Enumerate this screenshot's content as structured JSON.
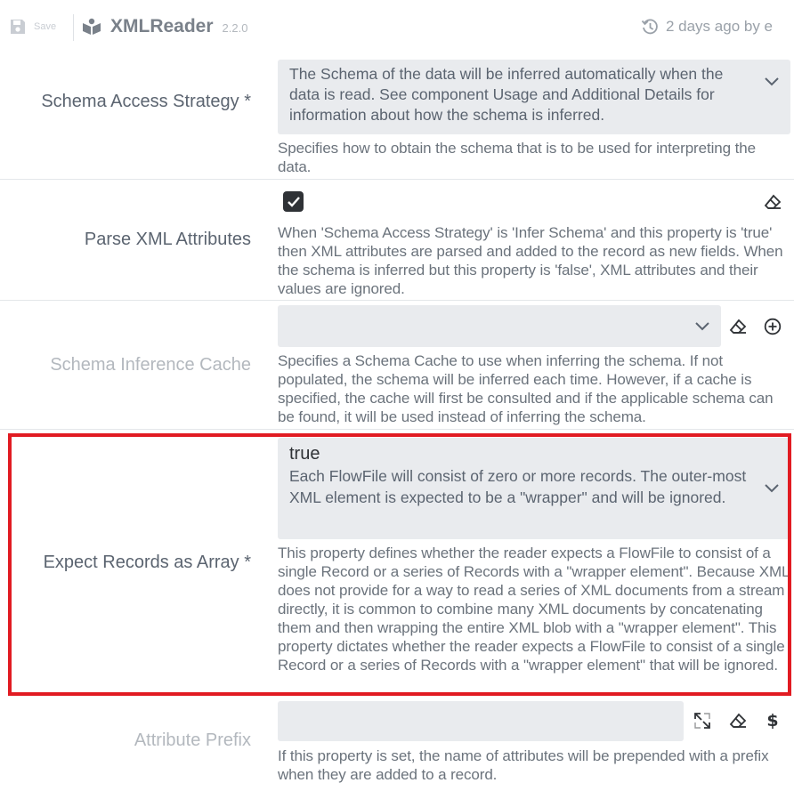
{
  "toolbar": {
    "save_label": "Save",
    "component_name": "XMLReader",
    "component_version": "2.2.0",
    "history_text": "2 days ago by e"
  },
  "properties": [
    {
      "label": "Schema Access Strategy *",
      "value": "The Schema of the data will be inferred automatically when the data is read. See component Usage and Additional Details for information about how the schema is inferred.",
      "description": "Specifies how to obtain the schema that is to be used for interpreting the data."
    },
    {
      "label": "Parse XML Attributes",
      "checked": true,
      "description": "When 'Schema Access Strategy' is 'Infer Schema' and this property is 'true' then XML attributes are parsed and added to the record as new fields. When the schema is inferred but this property is 'false', XML attributes and their values are ignored."
    },
    {
      "label": "Schema Inference Cache",
      "value": "",
      "description": "Specifies a Schema Cache to use when inferring the schema. If not populated, the schema will be inferred each time. However, if a cache is specified, the cache will first be consulted and if the applicable schema can be found, it will be used instead of inferring the schema."
    },
    {
      "label": "Expect Records as Array *",
      "value_title": "true",
      "value_description": "Each FlowFile will consist of zero or more records. The outer-most XML element is expected to be a \"wrapper\" and will be ignored.",
      "description": "This property defines whether the reader expects a FlowFile to consist of a single Record or a series of Records with a \"wrapper element\". Because XML does not provide for a way to read a series of XML documents from a stream directly, it is common to combine many XML documents by concatenating them and then wrapping the entire XML blob with a \"wrapper element\". This property dictates whether the reader expects a FlowFile to consist of a single Record or a series of Records with a \"wrapper element\" that will be ignored."
    },
    {
      "label": "Attribute Prefix",
      "value": "",
      "description": "If this property is set, the name of attributes will be prepended with a prefix when they are added to a record."
    }
  ],
  "icons": {
    "save": "floppy-disk-icon",
    "component": "component-box-icon",
    "history": "history-clock-icon",
    "clear": "eraser-icon",
    "add": "plus-circle-icon",
    "expand": "expand-arrows-icon",
    "expression": "dollar-icon"
  },
  "colors": {
    "highlight": "#e11b22",
    "field_bg": "#e9ebee",
    "checkbox": "#2f3236"
  }
}
